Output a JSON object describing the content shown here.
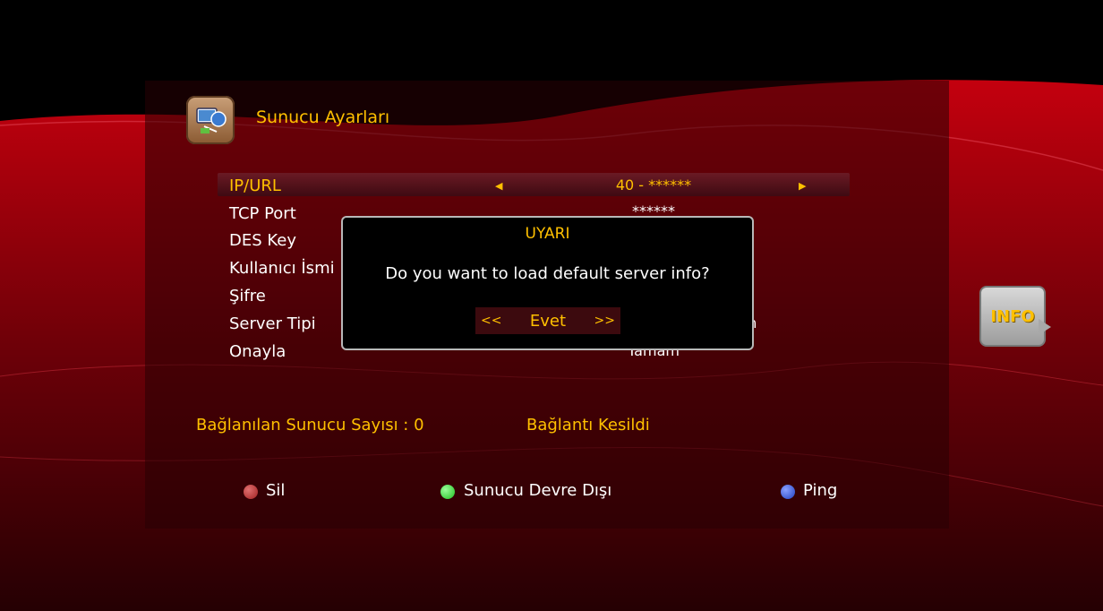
{
  "header": {
    "title": "Sunucu Ayarları",
    "icon": "network-settings-icon"
  },
  "rows": [
    {
      "label": "IP/URL",
      "value": "40 - ******",
      "selected": true
    },
    {
      "label": "TCP Port",
      "value": "******"
    },
    {
      "label": "DES Key",
      "value": ""
    },
    {
      "label": "Kullanıcı İsmi",
      "value": ""
    },
    {
      "label": "Şifre",
      "value": ""
    },
    {
      "label": "Server Tipi",
      "value": "...h"
    },
    {
      "label": "Onayla",
      "value": "Tamam"
    }
  ],
  "status": {
    "connected_label": "Bağlanılan Sunucu Sayısı : 0",
    "connection_state": "Bağlantı Kesildi"
  },
  "keys": {
    "red": {
      "label": "Sil",
      "color": "#a02020"
    },
    "green": {
      "label": "Sunucu Devre Dışı",
      "color": "#20c020"
    },
    "blue": {
      "label": "Ping",
      "color": "#2040c0"
    }
  },
  "info_button": {
    "label": "INFO"
  },
  "dialog": {
    "title": "UYARI",
    "message": "Do you want to load default server info?",
    "prev": "<<",
    "option": "Evet",
    "next": ">>"
  },
  "colors": {
    "accent": "#ffc000",
    "background": "#8a0010"
  }
}
